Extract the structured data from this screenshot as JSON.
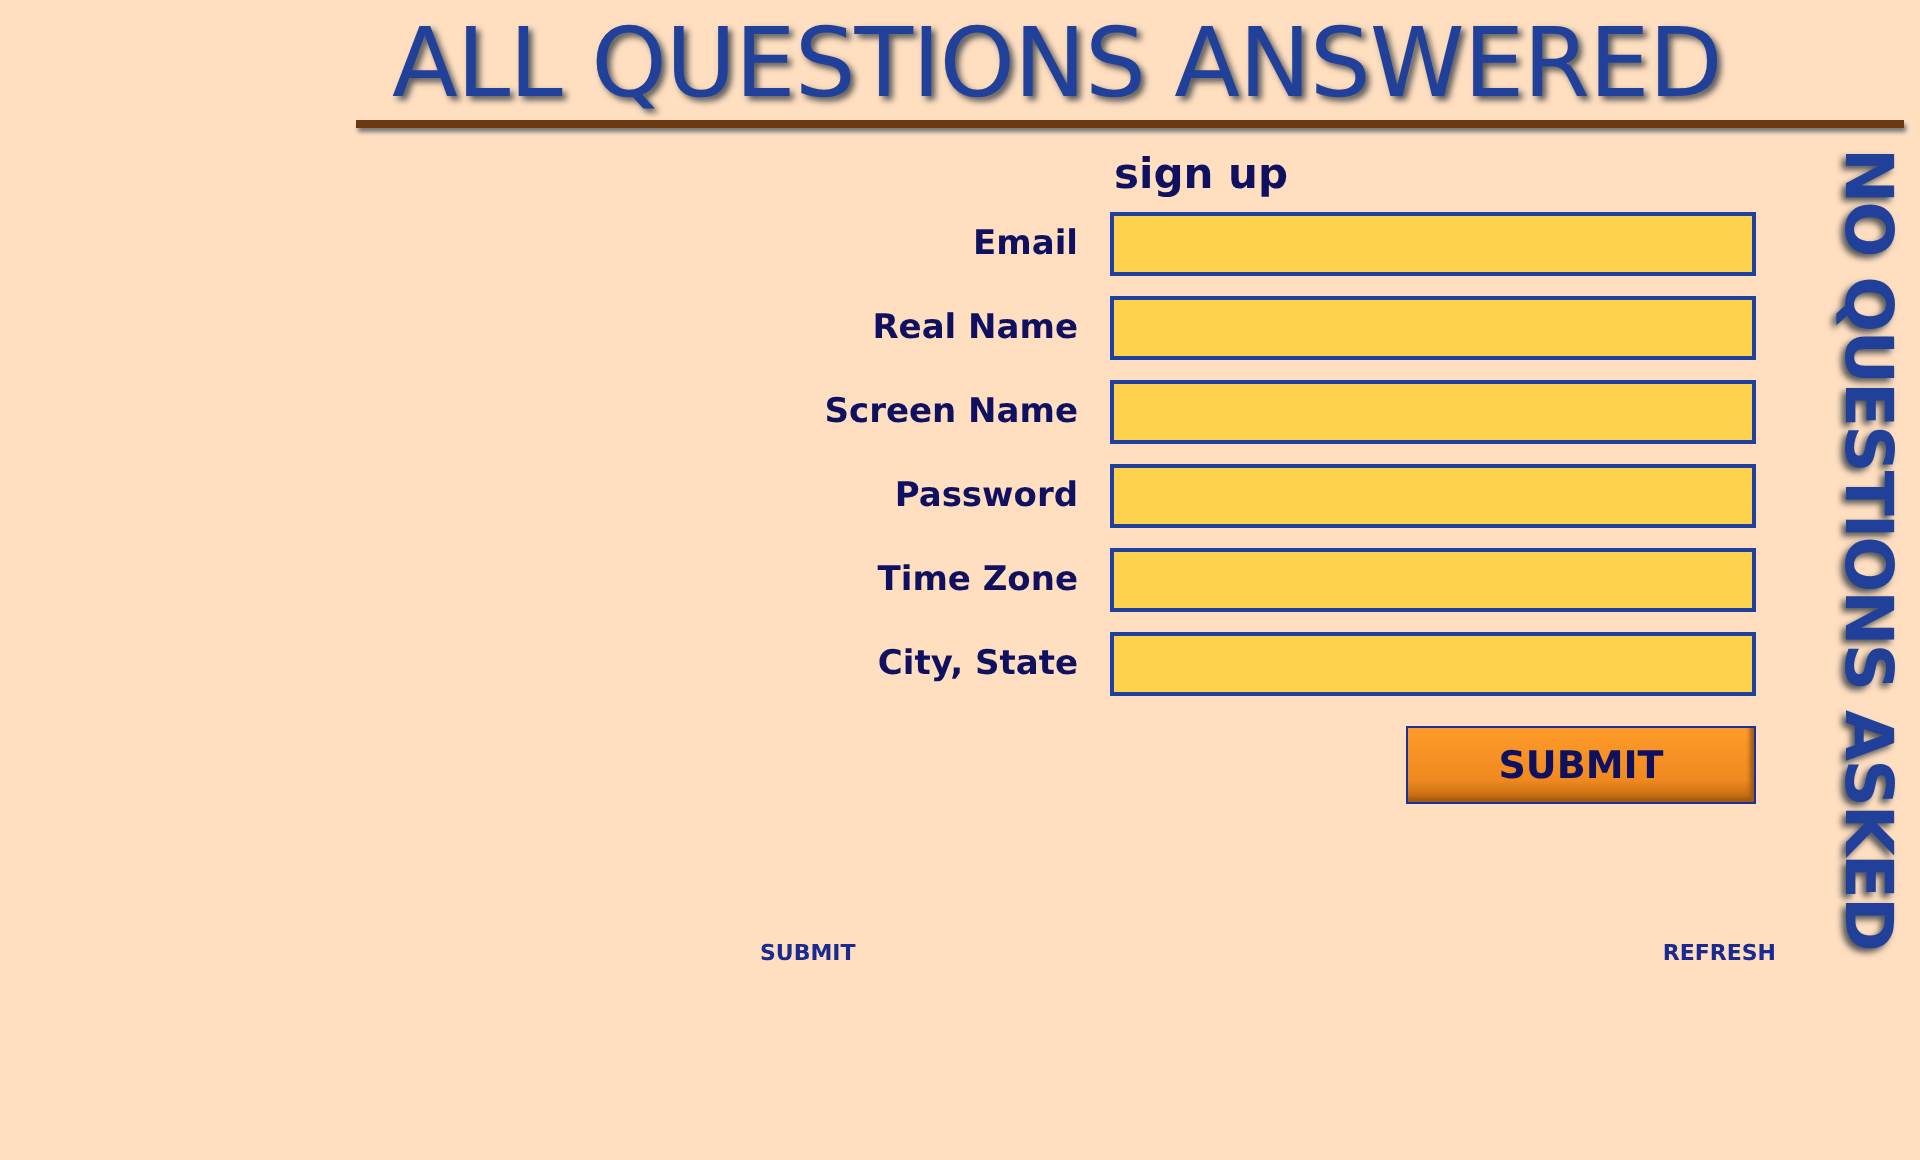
{
  "header": {
    "title": "ALL QUESTIONS ANSWERED",
    "side_title": "NO QUESTIONS ASKED"
  },
  "form": {
    "heading": "sign up",
    "fields": [
      {
        "label": "Email"
      },
      {
        "label": "Real Name"
      },
      {
        "label": "Screen Name"
      },
      {
        "label": "Password"
      },
      {
        "label": "Time Zone"
      },
      {
        "label": "City, State"
      }
    ],
    "submit": "SUBMIT"
  },
  "footer_links": [
    "SUBMIT",
    "REFRESH"
  ]
}
